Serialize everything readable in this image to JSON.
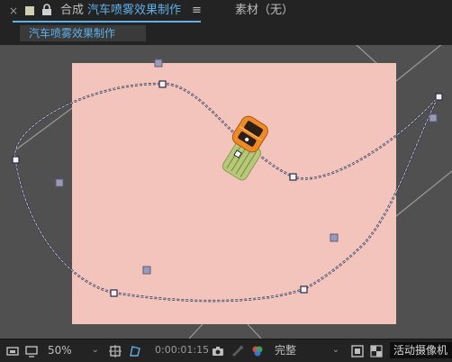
{
  "window": {
    "tab_close": "×",
    "tab_prefix": "合成",
    "composition_name": "汽车喷雾效果制作",
    "tab_menu": "≡",
    "footage_tab": "素材（无）",
    "breadcrumb": "汽车喷雾效果制作"
  },
  "footer": {
    "zoom": "50%",
    "timecode": "0:00:01:15",
    "quality": "完整",
    "camera_view": "活动摄像机"
  },
  "colors": {
    "accent": "#5fb0e8",
    "canvas": "#f2c4bb",
    "pasteboard": "#505050",
    "panel": "#232323"
  },
  "icons": [
    "close-icon",
    "composition-color-swatch",
    "lock-icon",
    "menu-icon",
    "preview-icon",
    "monitor-icon",
    "fit-icon",
    "mask-toggle-icon",
    "camera-snapshot-icon",
    "show-snapshot-icon",
    "color-channel-icon",
    "region-of-interest-icon",
    "transparency-grid-icon",
    "chevron-down-icon"
  ],
  "layer": {
    "name": "car",
    "description": "orange car top view with green spray trail"
  }
}
